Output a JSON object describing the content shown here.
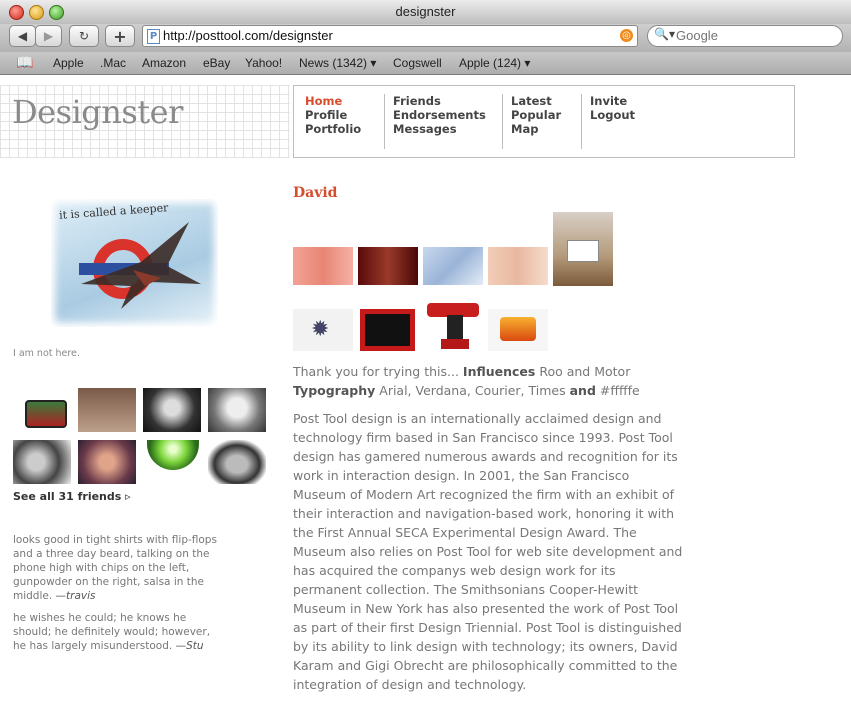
{
  "window": {
    "title": "designster"
  },
  "toolbar": {
    "back_icon": "back-arrow-icon",
    "forward_icon": "forward-arrow-icon",
    "url": "http://posttool.com/designster",
    "search_placeholder": "Google"
  },
  "bookmarks": [
    "Apple",
    ".Mac",
    "Amazon",
    "eBay",
    "Yahoo!",
    "News (1342) ▾",
    "Cogswell",
    "Apple (124) ▾"
  ],
  "site": {
    "logo": "Designster",
    "nav": {
      "col1": [
        "Home",
        "Profile",
        "Portfolio"
      ],
      "col2": [
        "Friends",
        "Endorsements",
        "Messages"
      ],
      "col3": [
        "Latest",
        "Popular",
        "Map"
      ],
      "col4": [
        "Invite",
        "Logout"
      ]
    }
  },
  "sidebar": {
    "feature_text": "it is called a keeper",
    "caption": "I am not here.",
    "see_all": "See all 31 friends",
    "quotes": [
      {
        "text": "looks good in tight shirts with flip-flops and a three day beard, talking on the phone high with chips on the left, gunpowder on the right, salsa in the middle. ",
        "author": "—travis"
      },
      {
        "text": "he wishes he could; he knows he should; he definitely would; however, he has largely misunderstood. ",
        "author": "—Stu"
      }
    ]
  },
  "profile": {
    "name": "David",
    "intro_lead": "Thank you for trying this...",
    "influences_label": "Influences",
    "influences_value": "Roo and Motor",
    "typography_label": "Typography",
    "typography_value": "Arial, Verdana, Courier, Times",
    "and_label": "and",
    "typography_color": "#fffffe",
    "bio": "Post Tool design is an internationally acclaimed design and technology firm based in San Francisco since 1993. Post Tool design has gamered numerous awards and recognition for its work in interaction design. In 2001, the San Francisco Museum of Modern Art recognized the firm with an exhibit of their interaction and navigation-based work, honoring it with the First Annual SECA Experimental Design Award. The Museum also relies on Post Tool for web site development and has acquired the companys web design work for its permanent collection. The Smithsonians Cooper-Hewitt Museum in New York has also presented the work of Post Tool as part of their first Design Triennial. Post Tool is distinguished by its ability to link design with technology; its owners, David Karam and Gigi Obrecht are philosophically committed to the integration of design and technology."
  },
  "colors": {
    "accent": "#d94c2b",
    "nav_text": "#444444",
    "body_text": "#777777"
  }
}
